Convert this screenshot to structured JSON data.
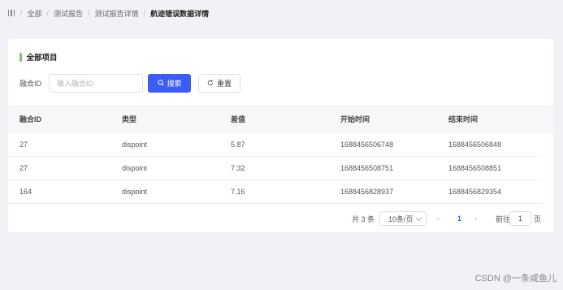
{
  "breadcrumb": {
    "items": [
      "全部",
      "测试报告",
      "测试报告详情"
    ],
    "current": "航迹错误数据详情"
  },
  "section": {
    "title": "全部项目"
  },
  "filter": {
    "label": "融合ID",
    "placeholder": "输入融合ID",
    "search_label": "搜索",
    "reset_label": "重置"
  },
  "table": {
    "columns": [
      "融合ID",
      "类型",
      "差值",
      "开始时间",
      "结束时间"
    ],
    "rows": [
      [
        "27",
        "dispoint",
        "5.87",
        "1688456506748",
        "1688456506848"
      ],
      [
        "27",
        "dispoint",
        "7.32",
        "1688456508751",
        "1688456508851"
      ],
      [
        "164",
        "dispoint",
        "7.16",
        "1688456828937",
        "1688456829354"
      ]
    ]
  },
  "pagination": {
    "total": "共 3 条",
    "page_size": "10条/页",
    "prev": "‹",
    "current": "1",
    "next": "›",
    "goto_label": "前往",
    "goto_value": "1",
    "page_label": "页"
  },
  "watermark": "CSDN @一条咸鱼儿"
}
